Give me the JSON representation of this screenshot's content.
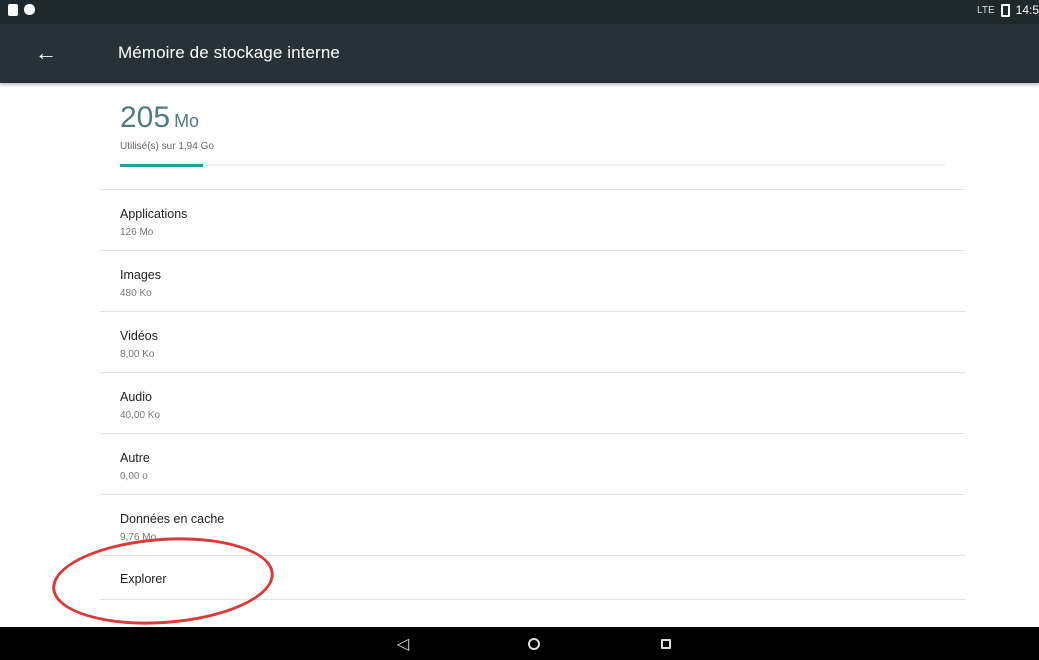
{
  "status_bar": {
    "time": "14:5",
    "signal_label": "LTE",
    "icons": [
      "sim-card-icon",
      "android-icon",
      "signal-icon",
      "battery-icon"
    ]
  },
  "app_bar": {
    "title": "Mémoire de stockage interne",
    "back_icon": "arrow-back-icon",
    "back_glyph": "←"
  },
  "summary": {
    "used_value": "205",
    "used_unit": "Mo",
    "subtitle": "Utilisé(s) sur 1,94 Go",
    "usage_fraction": 0.1
  },
  "categories": [
    {
      "title": "Applications",
      "size": "126 Mo"
    },
    {
      "title": "Images",
      "size": "480 Ko"
    },
    {
      "title": "Vidéos",
      "size": "8,00 Ko"
    },
    {
      "title": "Audio",
      "size": "40,00 Ko"
    },
    {
      "title": "Autre",
      "size": "0,00 o"
    },
    {
      "title": "Données en cache",
      "size": "9,76 Mo"
    },
    {
      "title": "Explorer",
      "size": ""
    }
  ],
  "nav_bar": {
    "back_glyph": "◁",
    "icons": [
      "nav-back-icon",
      "nav-home-icon",
      "nav-recent-icon"
    ]
  },
  "colors": {
    "app_bar": "#263238",
    "status_bar": "#1f282c",
    "accent": "#1ba39c",
    "used_text": "#4f7b84",
    "annotation": "#d93a3a"
  }
}
